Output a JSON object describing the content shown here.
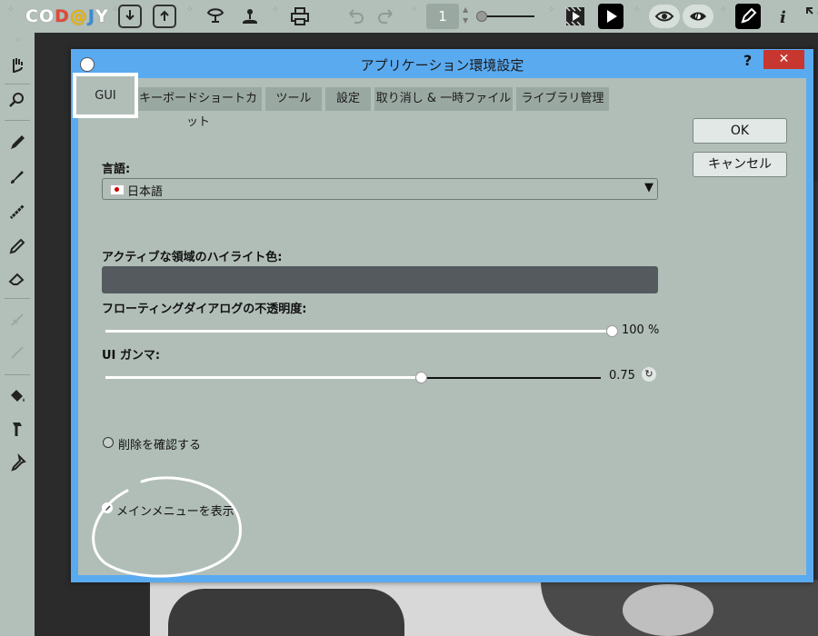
{
  "app": {
    "logo_parts": [
      "C",
      "O",
      "D",
      "@",
      "J",
      "Y"
    ],
    "logo_text": "CODAJY",
    "frame_number": "1"
  },
  "toolbar_icons": [
    "import-icon",
    "export-icon",
    "onion-skin-icon",
    "stamp-icon",
    "print-icon",
    "undo-icon",
    "redo-icon",
    "frame-counter",
    "playback-slider",
    "storyboard-icon",
    "play-icon",
    "eye-icon",
    "eye-alt-icon",
    "pencil-tool-icon",
    "info-icon",
    "fullscreen-icon"
  ],
  "left_tools": [
    "hand-icon",
    "zoom-icon",
    "pen-icon",
    "brush-icon",
    "pattern-brush-icon",
    "pencil-icon",
    "eraser-icon",
    "disabled-tool-1-icon",
    "disabled-tool-2-icon",
    "fill-bucket-icon",
    "hammer-icon",
    "eyedropper-icon"
  ],
  "dialog": {
    "title": "アプリケーション環境設定",
    "help": "?",
    "close": "✕",
    "tabs": [
      "GUI",
      "キーボードショートカット",
      "ツール",
      "設定",
      "取り消し & 一時ファイル",
      "ライブラリ管理"
    ],
    "active_tab": "GUI",
    "ok_label": "OK",
    "cancel_label": "キャンセル",
    "language": {
      "label": "言語:",
      "value": "日本語",
      "arrow": "▼"
    },
    "highlight": {
      "label": "アクティブな領域のハイライト色:",
      "color": "#545a5e"
    },
    "opacity": {
      "label": "フローティングダイアログの不透明度:",
      "value_text": "100 %",
      "value": 100,
      "max": 100
    },
    "gamma": {
      "label": "UI ガンマ:",
      "value_text": "0.75",
      "value": 0.75,
      "reset_icon": "↻"
    },
    "confirm_delete": {
      "label": "削除を確認する",
      "checked": false
    },
    "show_main_menu": {
      "label": "メインメニューを表示",
      "checked": true
    }
  },
  "colors": {
    "toolbar_bg": "#b3c0ba",
    "dialog_frame": "#5aaaf0",
    "dialog_body": "#b1beb8",
    "close_red": "#c7372f"
  }
}
